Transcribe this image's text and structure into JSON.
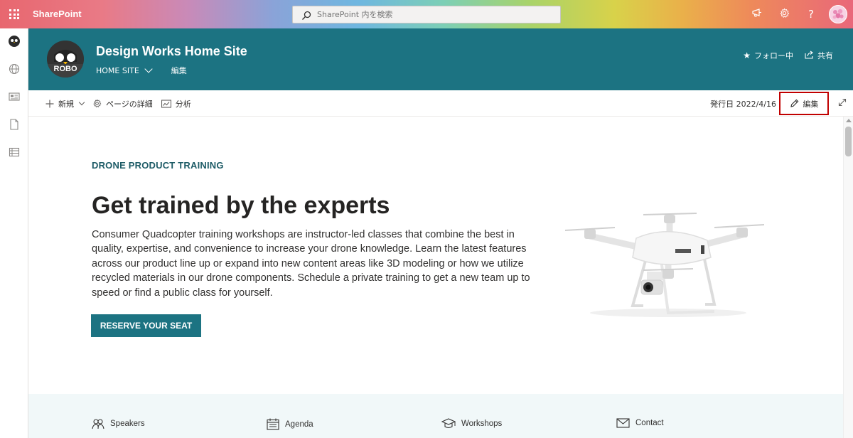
{
  "suite": {
    "brand": "SharePoint",
    "search_placeholder": "SharePoint 内を検索",
    "icons": [
      "waffle-icon",
      "megaphone-icon",
      "gear-icon",
      "help-icon",
      "avatar"
    ],
    "help_glyph": "?"
  },
  "rail": {
    "items": [
      "home-icon",
      "globe-icon",
      "news-icon",
      "file-icon",
      "list-icon"
    ]
  },
  "site": {
    "logo_text": "ROBO",
    "title": "Design Works Home Site",
    "nav": [
      "HOME SITE",
      "編集"
    ],
    "follow_label": "フォロー中",
    "share_label": "共有"
  },
  "command_bar": {
    "new_label": "新規",
    "page_details_label": "ページの詳細",
    "analytics_label": "分析",
    "published": "発行日 2022/4/16",
    "edit_label": "編集"
  },
  "hero": {
    "eyebrow": "DRONE PRODUCT TRAINING",
    "title": "Get trained by the experts",
    "body": "Consumer Quadcopter training workshops are instructor-led classes that combine the best in quality, expertise, and convenience to increase your drone knowledge. Learn the latest features across our product line up or expand into new content areas like 3D modeling or how we utilize recycled materials in our drone components. Schedule a private training to get a new team up to speed or find a public class for yourself.",
    "cta_label": "RESERVE YOUR SEAT"
  },
  "bottom_nav": [
    {
      "label": "Speakers",
      "icon": "people-icon"
    },
    {
      "label": "Agenda",
      "icon": "calendar-icon"
    },
    {
      "label": "Workshops",
      "icon": "education-icon"
    },
    {
      "label": "Contact",
      "icon": "mail-icon"
    }
  ],
  "colors": {
    "site_header": "#1c7382",
    "accent_dark": "#1d5b66",
    "highlight_border": "#c00000",
    "band_bg": "#f1f8f9"
  }
}
